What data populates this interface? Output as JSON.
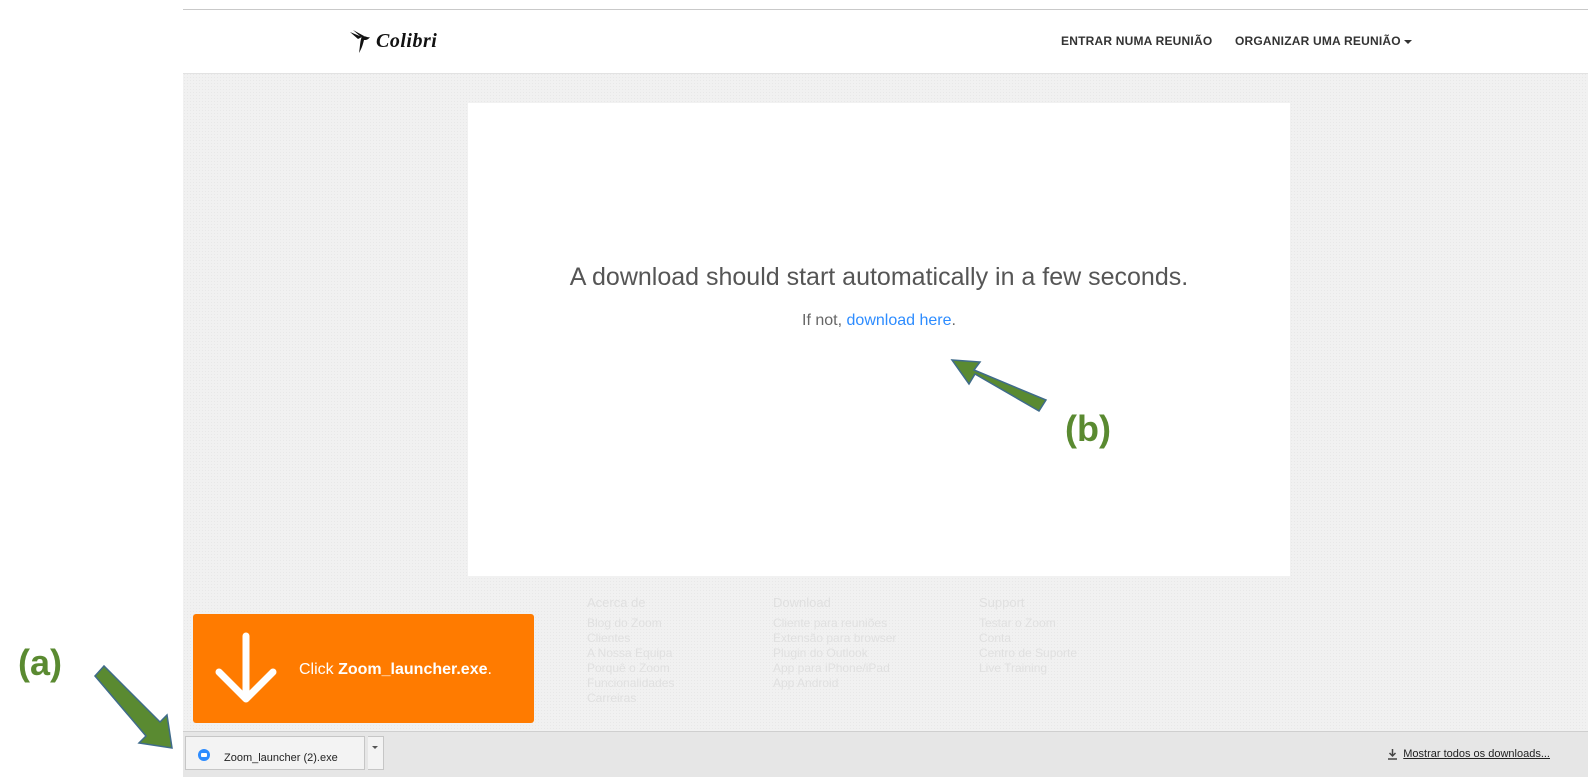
{
  "header": {
    "logo_text": "Colibri",
    "nav_join": "ENTRAR NUMA REUNIÃO",
    "nav_host": "ORGANIZAR UMA REUNIÃO"
  },
  "main": {
    "message": "A download should start automatically in a few seconds.",
    "sub_prefix": "If not, ",
    "sub_link": "download here",
    "sub_suffix": "."
  },
  "footer": {
    "col1": {
      "title": "Acerca de",
      "items": [
        "Blog do Zoom",
        "Clientes",
        "A Nossa Equipa",
        "Porquê o Zoom",
        "Funcionalidades",
        "Carreiras"
      ]
    },
    "col2": {
      "title": "Download",
      "items": [
        "Cliente para reuniões",
        "Extensão para browser",
        "Plugin do Outlook",
        "App para iPhone/iPad",
        "App Android"
      ]
    },
    "col3": {
      "title": "Support",
      "items": [
        "Testar o Zoom",
        "Conta",
        "Centro de Suporte",
        "Live Training"
      ]
    }
  },
  "tip": {
    "prefix": "Click ",
    "filename": "Zoom_launcher.exe",
    "suffix": "."
  },
  "download_bar": {
    "file_name": "Zoom_launcher (2).exe",
    "show_all": "Mostrar todos os downloads..."
  },
  "annotations": {
    "a": "(a)",
    "b": "(b)"
  },
  "colors": {
    "accent_orange": "#ff7b00",
    "link_blue": "#2d8cff",
    "annotation_green": "#5a8a31"
  }
}
